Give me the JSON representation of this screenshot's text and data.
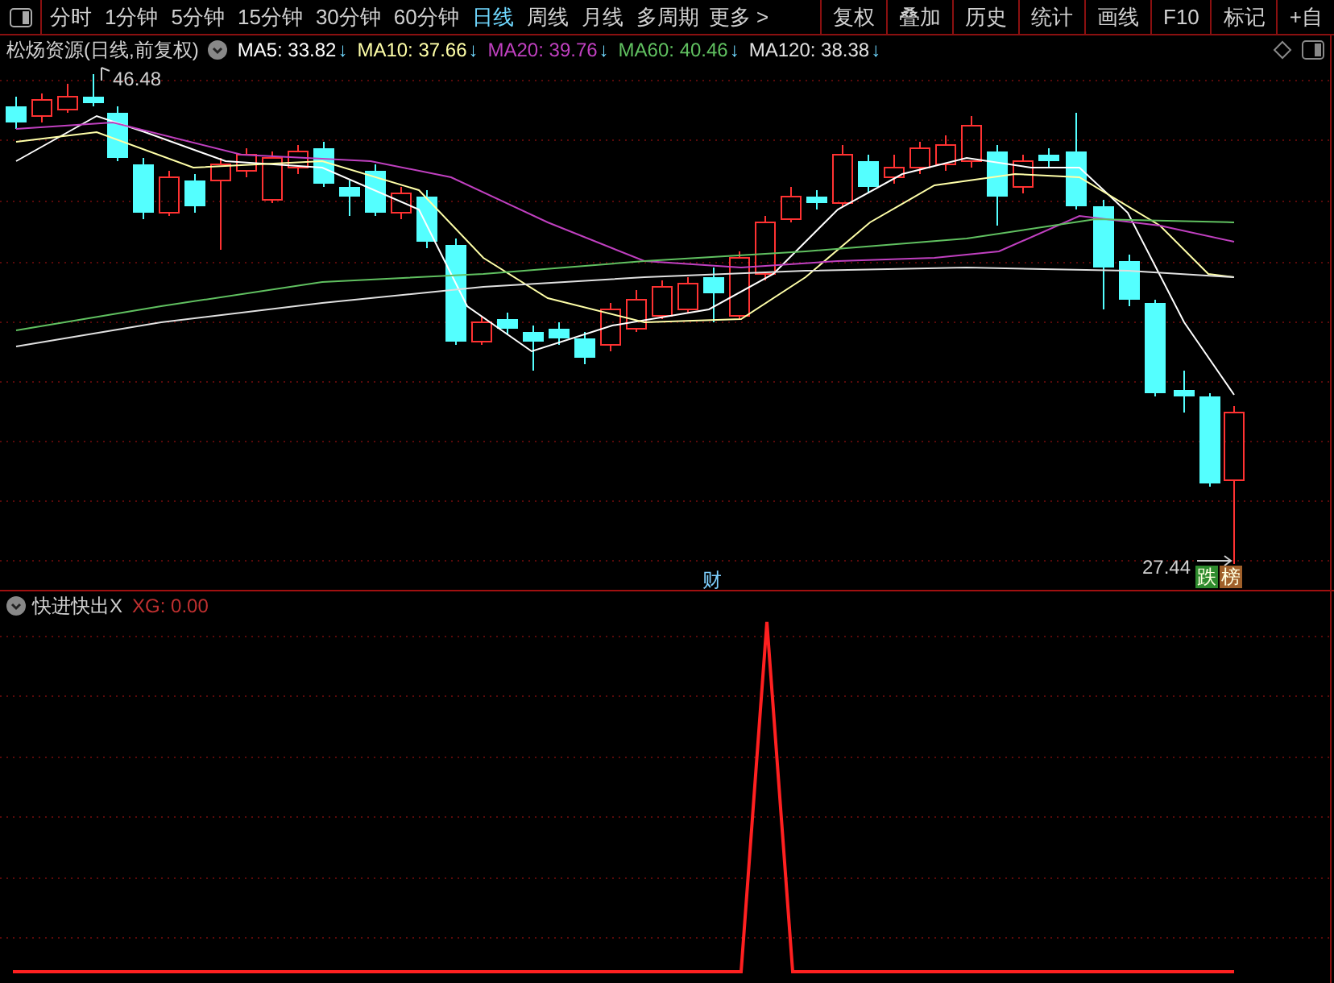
{
  "toolbar": {
    "periods": [
      {
        "label": "分时",
        "selected": false
      },
      {
        "label": "1分钟",
        "selected": false
      },
      {
        "label": "5分钟",
        "selected": false
      },
      {
        "label": "15分钟",
        "selected": false
      },
      {
        "label": "30分钟",
        "selected": false
      },
      {
        "label": "60分钟",
        "selected": false
      },
      {
        "label": "日线",
        "selected": true
      },
      {
        "label": "周线",
        "selected": false
      },
      {
        "label": "月线",
        "selected": false
      },
      {
        "label": "多周期",
        "selected": false
      }
    ],
    "more": "更多 >",
    "buttons": [
      "复权",
      "叠加",
      "历史",
      "统计",
      "画线",
      "F10",
      "标记",
      "+自"
    ]
  },
  "main_chart": {
    "title": "松炀资源(日线,前复权)",
    "moving_averages": [
      {
        "label": "MA5: 33.82",
        "arrow": "↓",
        "color": "#ffffff"
      },
      {
        "label": "MA10: 37.66",
        "arrow": "↓",
        "color": "#ffffa8"
      },
      {
        "label": "MA20: 39.76",
        "arrow": "↓",
        "color": "#c040c0"
      },
      {
        "label": "MA60: 40.46",
        "arrow": "↓",
        "color": "#60c060"
      },
      {
        "label": "MA120: 38.38",
        "arrow": "↓",
        "color": "#e0e0e0"
      }
    ],
    "high_label": "46.48",
    "low_label": "27.44",
    "event_badge": "财",
    "badges": [
      {
        "text": "跌",
        "color": "#2e8b2e"
      },
      {
        "text": "榜",
        "color": "#a0602a"
      }
    ]
  },
  "indicator": {
    "name": "快进快出X",
    "value": "XG: 0.00"
  }
}
